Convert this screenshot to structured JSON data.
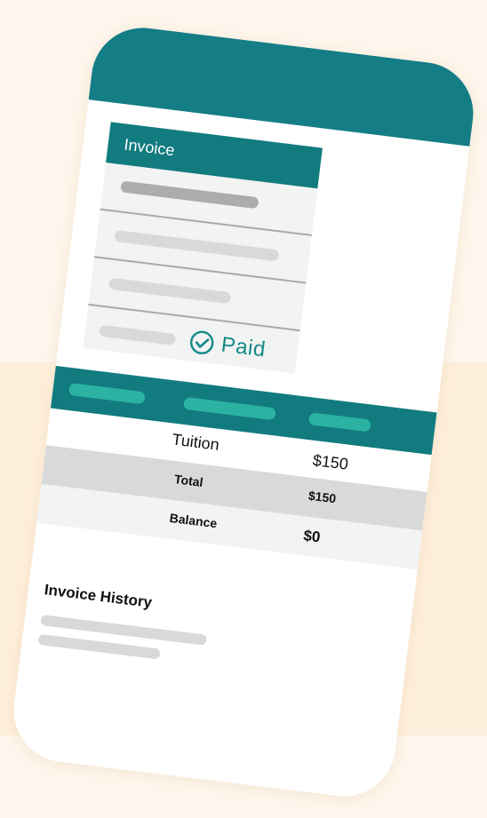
{
  "invoice_card": {
    "title": "Invoice",
    "status": "Paid",
    "status_icon": "check-circle-icon"
  },
  "charges_table": {
    "rows": [
      {
        "label": "Tuition",
        "value": "$150"
      },
      {
        "label": "Total",
        "value": "$150"
      },
      {
        "label": "Balance",
        "value": "$0"
      }
    ]
  },
  "history": {
    "title": "Invoice History"
  },
  "colors": {
    "header": "#157d86",
    "accent": "#127b7f",
    "paid": "#148a86",
    "background": "#fdf6ec"
  }
}
